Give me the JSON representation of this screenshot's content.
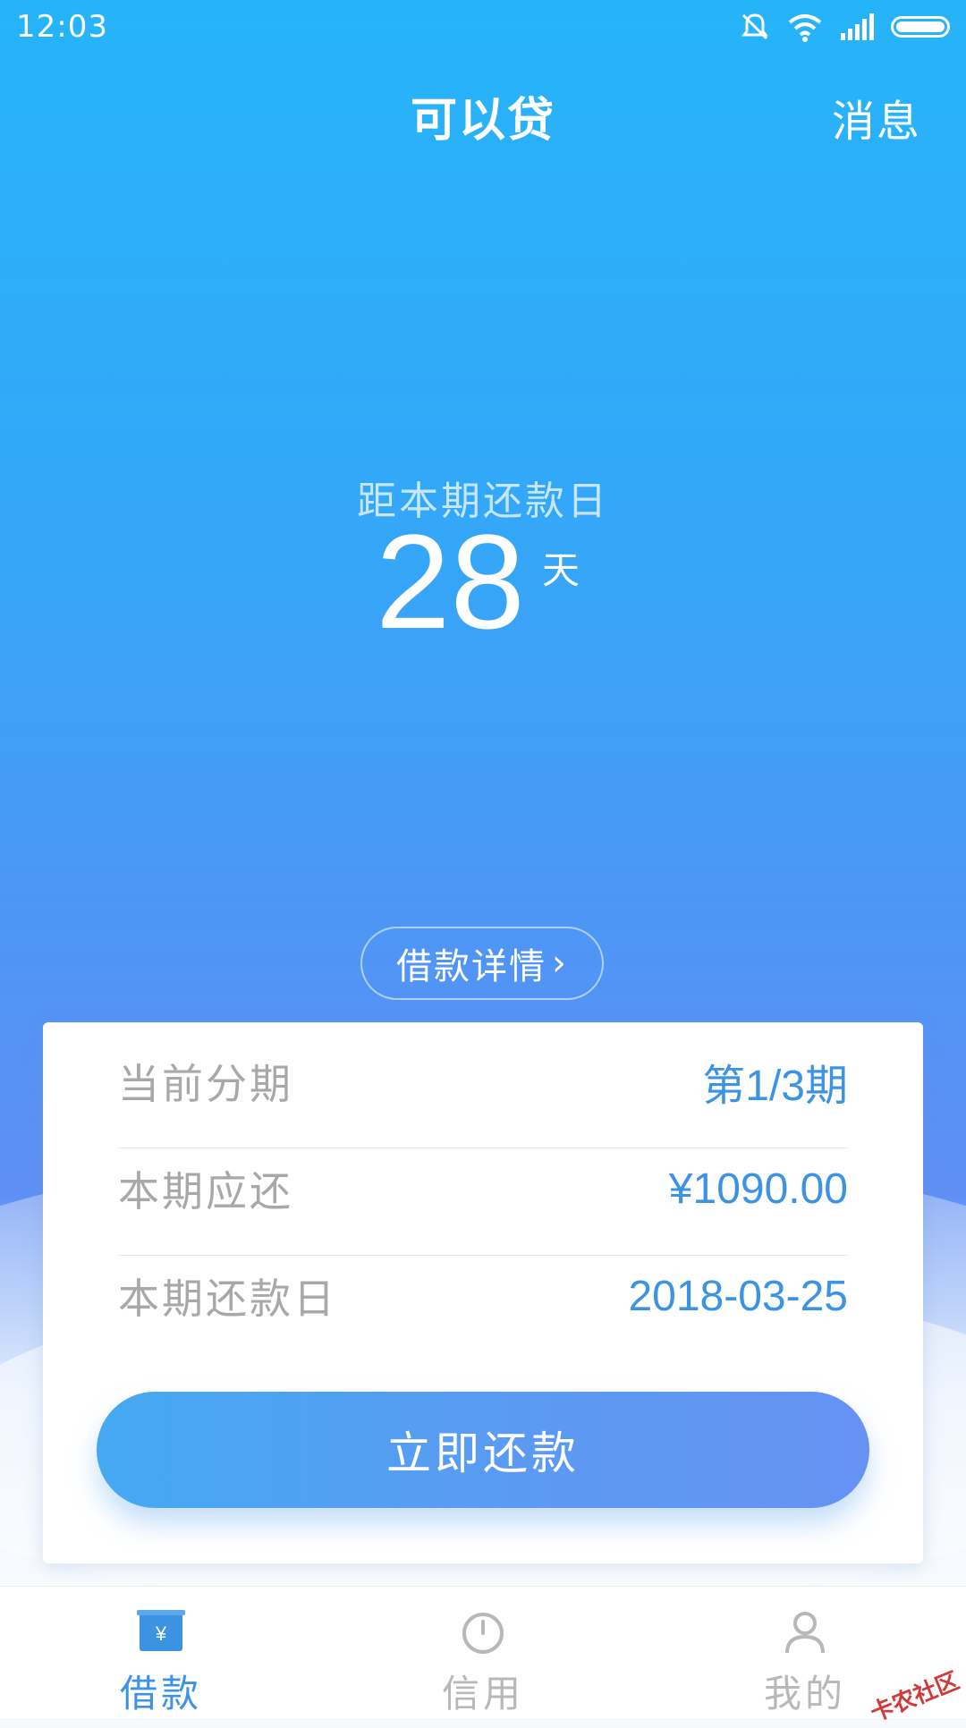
{
  "status_bar": {
    "time": "12:03",
    "icons": [
      "mute-icon",
      "wifi-icon",
      "signal-icon",
      "battery-icon"
    ]
  },
  "header": {
    "title": "可以贷",
    "message_link": "消息"
  },
  "countdown": {
    "label": "距本期还款日",
    "days": "28",
    "unit": "天"
  },
  "detail_button": {
    "label": "借款详情",
    "chevron": "›"
  },
  "card": {
    "rows": [
      {
        "label": "当前分期",
        "value": "第1/3期"
      },
      {
        "label": "本期应还",
        "value": "¥1090.00"
      },
      {
        "label": "本期还款日",
        "value": "2018-03-25"
      }
    ],
    "repay_button": "立即还款"
  },
  "bottom_nav": {
    "items": [
      {
        "label": "借款",
        "icon": "loan-icon",
        "active": true
      },
      {
        "label": "信用",
        "icon": "gauge-icon",
        "active": false
      },
      {
        "label": "我的",
        "icon": "person-icon",
        "active": false
      }
    ]
  },
  "watermark": "卡农社区",
  "colors": {
    "primary_blue": "#3d93e3",
    "header_gradient_top": "#26b4f9",
    "header_gradient_bottom": "#5f8ff4",
    "label_gray": "#a8a8a8"
  }
}
